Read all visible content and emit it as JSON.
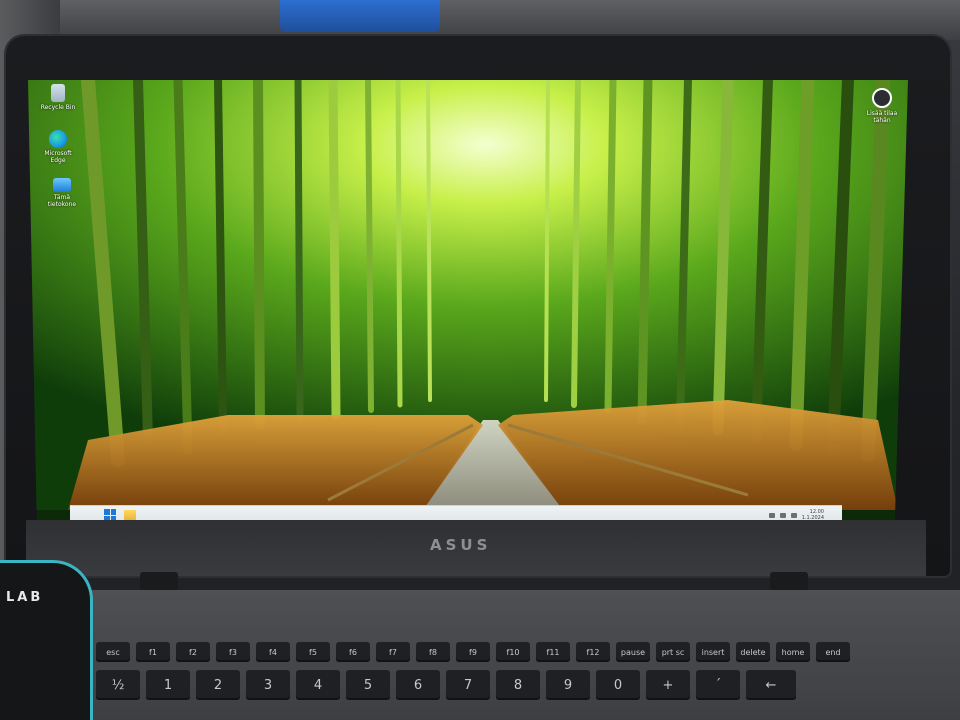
{
  "desktop": {
    "icons_left": [
      {
        "label": "Recycle Bin",
        "icon": "recycle-bin-icon"
      },
      {
        "label": "Microsoft Edge",
        "icon": "edge-icon"
      },
      {
        "label": "Tämä tietokone",
        "icon": "this-pc-icon"
      }
    ],
    "icon_right": {
      "label": "Lisää tilaa tähän",
      "icon": "restore-icon"
    }
  },
  "taskbar": {
    "start_icon": "windows-start-icon",
    "pinned": [
      {
        "icon": "file-explorer-icon"
      }
    ],
    "tray": {
      "time": "12.00",
      "date": "1.1.2024"
    }
  },
  "laptop": {
    "lid_brand": "ASUS",
    "mousepad_text": "LAB"
  },
  "keyboard": {
    "fn_keys": [
      "esc",
      "f1",
      "f2",
      "f3",
      "f4",
      "f5",
      "f6",
      "f7",
      "f8",
      "f9",
      "f10",
      "f11",
      "f12",
      "pause",
      "prt sc",
      "insert",
      "delete",
      "home",
      "end"
    ],
    "num_keys": [
      "½",
      "1",
      "2",
      "3",
      "4",
      "5",
      "6",
      "7",
      "8",
      "9",
      "0",
      "+",
      "´",
      "←"
    ]
  },
  "colors": {
    "bamboo_light": "#b8e83a",
    "bamboo_dark": "#0f3d0a",
    "grass": "#c8801e",
    "taskbar": "#e6eced",
    "accent": "#1d78d6"
  }
}
